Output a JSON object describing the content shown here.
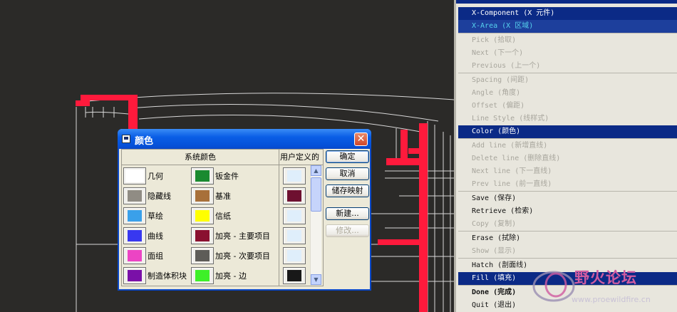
{
  "dialog": {
    "title": "颜色",
    "system_colors_header": "系统颜色",
    "user_defined_header": "用户定义的",
    "system_colors": [
      {
        "label": "几何",
        "color": "#ffffff"
      },
      {
        "label": "隐藏线",
        "color": "#908c84"
      },
      {
        "label": "草绘",
        "color": "#3aa0ea"
      },
      {
        "label": "曲线",
        "color": "#3838f0"
      },
      {
        "label": "面组",
        "color": "#ec44c4"
      },
      {
        "label": "制造体积块",
        "color": "#7a10a8"
      },
      {
        "label": "钣金件",
        "color": "#1a8a30"
      },
      {
        "label": "基准",
        "color": "#a8703a"
      },
      {
        "label": "信纸",
        "color": "#ffff00"
      },
      {
        "label": "加亮 - 主要项目",
        "color": "#8a1030"
      },
      {
        "label": "加亮 - 次要项目",
        "color": "#5e5c58"
      },
      {
        "label": "加亮 - 边",
        "color": "#3ef028"
      }
    ],
    "user_colors": [
      "#dfeefb",
      "#6e1030",
      "#dfeefb",
      "#dfeefb",
      "#dfeefb",
      "#181818"
    ],
    "buttons": {
      "ok": "确定",
      "cancel": "取消",
      "save_map": "储存映射",
      "new": "新建...",
      "modify": "修改..."
    }
  },
  "menu": {
    "items": [
      {
        "label": "X-Component (X 元件)",
        "state": "selected"
      },
      {
        "label": "X-Area (X 区域)",
        "state": "highlight"
      },
      {
        "label": "Pick (拾取)",
        "state": "disabled"
      },
      {
        "label": "Next (下一个)",
        "state": "disabled"
      },
      {
        "label": "Previous (上一个)",
        "state": "disabled"
      },
      {
        "label": "Spacing (间距)",
        "state": "disabled"
      },
      {
        "label": "Angle (角度)",
        "state": "disabled"
      },
      {
        "label": "Offset (偏距)",
        "state": "disabled"
      },
      {
        "label": "Line Style (线样式)",
        "state": "disabled"
      },
      {
        "label": "Color (颜色)",
        "state": "selected"
      },
      {
        "label": "Add line (新增直线)",
        "state": "disabled"
      },
      {
        "label": "Delete line (删除直线)",
        "state": "disabled"
      },
      {
        "label": "Next line (下一直线)",
        "state": "disabled"
      },
      {
        "label": "Prev line (前一直线)",
        "state": "disabled"
      },
      {
        "label": "Save (保存)",
        "state": "enabled"
      },
      {
        "label": "Retrieve (检索)",
        "state": "enabled"
      },
      {
        "label": "Copy (复制)",
        "state": "disabled"
      },
      {
        "label": "Erase (拭除)",
        "state": "enabled"
      },
      {
        "label": "Show (显示)",
        "state": "disabled"
      },
      {
        "label": "Hatch (剖面线)",
        "state": "enabled"
      },
      {
        "label": "Fill (填充)",
        "state": "selected"
      },
      {
        "label": "Done (完成)",
        "state": "bold"
      },
      {
        "label": "Quit (退出)",
        "state": "enabled"
      }
    ]
  },
  "watermark": {
    "brand": "野火论坛",
    "url": "www.proewildfire.cn"
  },
  "colors": {
    "accent_red": "#ff1a3c",
    "canvas_bg": "#2b2a28",
    "menu_selected": "#0b2a86"
  }
}
